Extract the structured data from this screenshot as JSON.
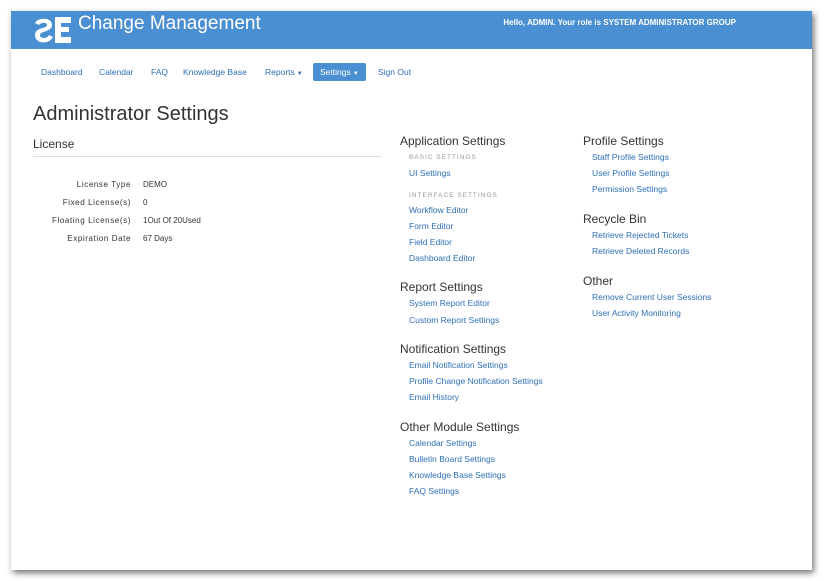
{
  "header": {
    "app_title": "Change Management",
    "greeting": "Hello, ADMIN. Your role is SYSTEM ADMINISTRATOR GROUP"
  },
  "nav": {
    "items": [
      "Dashboard",
      "Calendar",
      "FAQ",
      "Knowledge Base",
      "Reports",
      "Settings",
      "Sign Out"
    ],
    "active": "Settings"
  },
  "page": {
    "title": "Administrator Settings"
  },
  "license": {
    "title": "License",
    "rows": [
      {
        "label": "License Type",
        "value": "DEMO"
      },
      {
        "label": "Fixed License(s)",
        "value": "0"
      },
      {
        "label": "Floating License(s)",
        "value": "1Out Of 20Used"
      },
      {
        "label": "Expiration Date",
        "value": "67 Days"
      }
    ]
  },
  "application_settings": {
    "title": "Application Settings",
    "basic_label": "BASIC SETTINGS",
    "basic_links": [
      "UI Settings"
    ],
    "interface_label": "INTERFACE SETTINGS",
    "interface_links": [
      "Workflow Editor",
      "Form Editor",
      "Field Editor",
      "Dashboard Editor"
    ]
  },
  "report_settings": {
    "title": "Report Settings",
    "links": [
      "System Report Editor",
      "Custom Report Settings"
    ]
  },
  "notification_settings": {
    "title": "Notification Settings",
    "links": [
      "Email Notification Settings",
      "Profile Change Notification Settings",
      "Email History"
    ]
  },
  "other_module_settings": {
    "title": "Other Module Settings",
    "links": [
      "Calendar Settings",
      "Bulletin Board Settings",
      "Knowledge Base Settings",
      "FAQ Settings"
    ]
  },
  "profile_settings": {
    "title": "Profile Settings",
    "links": [
      "Staff Profile Settings",
      "User Profile Settings",
      "Permission Settings"
    ]
  },
  "recycle_bin": {
    "title": "Recycle Bin",
    "links": [
      "Retrieve Rejected Tickets",
      "Retrieve Deleted Records"
    ]
  },
  "other": {
    "title": "Other",
    "links": [
      "Remove Current User Sessions",
      "User Activity Monitoring"
    ]
  },
  "colors": {
    "brand": "#4a8fd1",
    "link": "#2d6fb5"
  },
  "icons": {
    "logo": "se-logo-icon",
    "caret": "caret-down-icon"
  }
}
